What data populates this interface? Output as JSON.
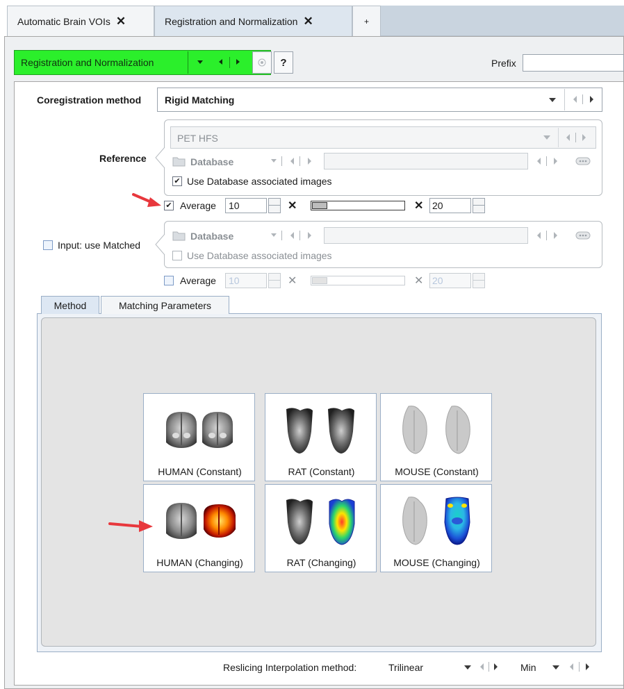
{
  "tabs": [
    {
      "label": "Automatic Brain VOIs",
      "close": "✕"
    },
    {
      "label": "Registration and Normalization",
      "close": "✕"
    }
  ],
  "tab_add": "+",
  "plugin_bar": {
    "label": "Registration and Normalization",
    "help": "?",
    "prefix_label": "Prefix",
    "prefix_value": ""
  },
  "coreg": {
    "label": "Coregistration method",
    "value": "Rigid Matching"
  },
  "reference": {
    "label": "Reference",
    "image": "PET HFS",
    "source": "Database",
    "use_db_label": "Use Database associated images",
    "use_db_checked": true,
    "average_label": "Average",
    "average_checked": true,
    "average_value": "10",
    "times": "✕",
    "average_value2": "20"
  },
  "input": {
    "label": "Input: use Matched",
    "checked": false,
    "source": "Database",
    "use_db_label": "Use Database associated images",
    "average_label": "Average",
    "average_value": "10",
    "times": "✕",
    "average_value2": "20"
  },
  "method_tabs": [
    {
      "label": "Method",
      "active": true
    },
    {
      "label": "Matching Parameters",
      "active": false
    }
  ],
  "templates": [
    {
      "label": "HUMAN (Constant)",
      "icon": "human-brain-icon"
    },
    {
      "label": "RAT (Constant)",
      "icon": "rat-brain-icon"
    },
    {
      "label": "MOUSE (Constant)",
      "icon": "mouse-brain-icon"
    },
    {
      "label": "HUMAN (Changing)",
      "icon": "human-brain-changing-icon"
    },
    {
      "label": "RAT (Changing)",
      "icon": "rat-brain-changing-icon"
    },
    {
      "label": "MOUSE (Changing)",
      "icon": "mouse-brain-changing-icon"
    }
  ],
  "footer": {
    "reslicing_label": "Reslicing Interpolation method:",
    "reslicing_value": "Trilinear",
    "min_value": "Min"
  },
  "colors": {
    "plugin_green": "#2bef2b",
    "annotation_arrow": "#e8383d"
  }
}
